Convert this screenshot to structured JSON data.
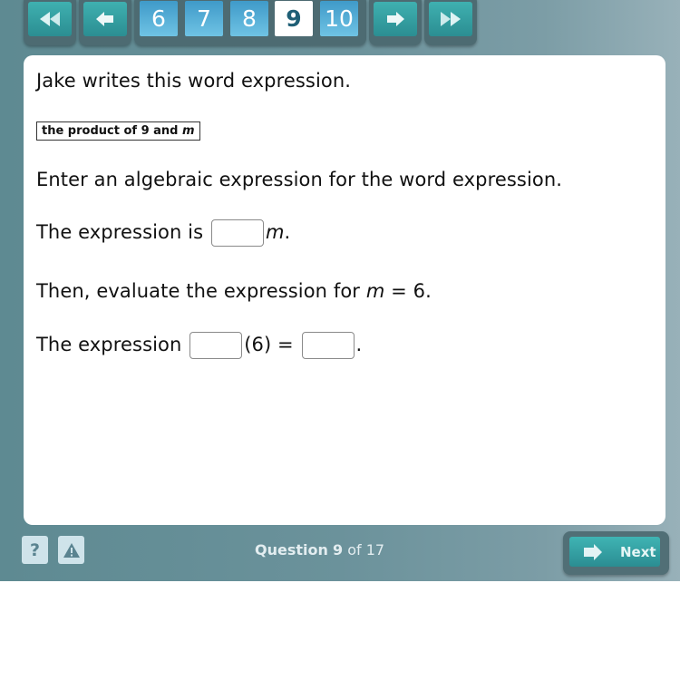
{
  "nav": {
    "first_icon": "double-left-arrow-icon",
    "prev_icon": "left-arrow-icon",
    "pages": [
      "6",
      "7",
      "8",
      "9",
      "10"
    ],
    "current_page": "9",
    "next_icon": "right-arrow-icon",
    "last_icon": "double-right-arrow-icon"
  },
  "question": {
    "intro": "Jake writes this word expression.",
    "word_expression_prefix": "the product of 9 and ",
    "word_expression_var": "m",
    "instruction": "Enter an algebraic expression for the word expression.",
    "line1_prefix": "The expression is",
    "line1_var": "m",
    "line1_suffix": ".",
    "line2_prefix": "Then, evaluate the expression for ",
    "line2_var": "m",
    "line2_suffix": " = 6.",
    "line3_prefix": "The expression",
    "line3_middle": "(6) =",
    "line3_suffix": ".",
    "inputs": {
      "coefficient": "",
      "evaluate_coefficient": "",
      "evaluate_result": ""
    }
  },
  "footer": {
    "help_label": "?",
    "help_icon": "question-icon",
    "flag_icon": "warning-triangle-icon",
    "counter_word": "Question",
    "counter_current": "9",
    "counter_of": "of 17",
    "next_label": "Next",
    "next_icon": "right-arrow-icon"
  }
}
